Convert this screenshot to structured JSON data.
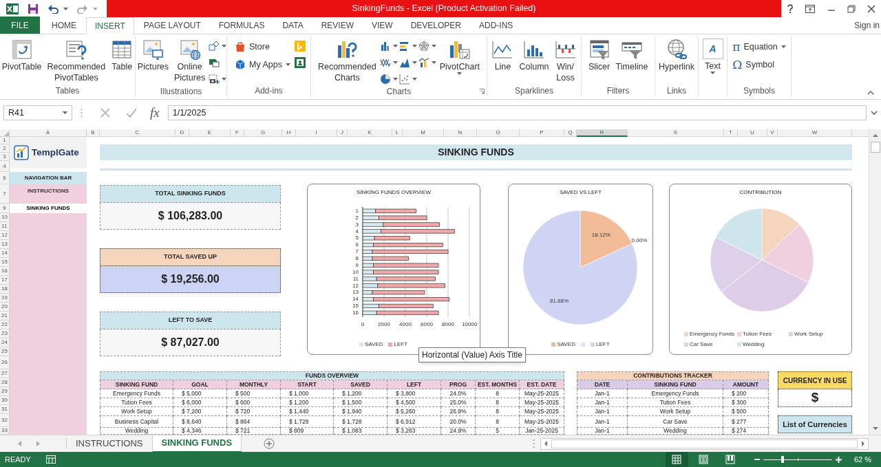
{
  "window": {
    "title": "SinkingFunds -  Excel (Product Activation Failed)"
  },
  "ribbon_tabs": [
    {
      "label": "FILE",
      "kind": "file",
      "selected": false
    },
    {
      "label": "HOME",
      "kind": "tab",
      "selected": false
    },
    {
      "label": "INSERT",
      "kind": "tab",
      "selected": true
    },
    {
      "label": "PAGE LAYOUT",
      "kind": "tab",
      "selected": false
    },
    {
      "label": "FORMULAS",
      "kind": "tab",
      "selected": false
    },
    {
      "label": "DATA",
      "kind": "tab",
      "selected": false
    },
    {
      "label": "REVIEW",
      "kind": "tab",
      "selected": false
    },
    {
      "label": "VIEW",
      "kind": "tab",
      "selected": false
    },
    {
      "label": "DEVELOPER",
      "kind": "tab",
      "selected": false
    },
    {
      "label": "ADD-INS",
      "kind": "tab",
      "selected": false
    }
  ],
  "sign_in": "Sign in",
  "ribbon_groups": [
    {
      "label": "Tables",
      "items": [
        {
          "kind": "large",
          "label": "PivotTable"
        },
        {
          "kind": "large",
          "label": "Recommended\nPivotTables"
        },
        {
          "kind": "large",
          "label": "Table"
        }
      ]
    },
    {
      "label": "Illustrations",
      "items": [
        {
          "kind": "large",
          "label": "Pictures"
        },
        {
          "kind": "large",
          "label": "Online\nPictures"
        },
        {
          "kind": "stack",
          "icons": [
            {
              "dropdown": true
            },
            {
              "dropdown": false
            },
            {
              "dropdown": true
            }
          ]
        }
      ]
    },
    {
      "label": "Add-ins",
      "items": [
        {
          "kind": "rows",
          "entries": [
            {
              "label": "Store",
              "dropdown": false
            },
            {
              "label": "My Apps",
              "dropdown": true
            }
          ]
        },
        {
          "kind": "stack",
          "icons": [
            {
              "dropdown": false
            },
            {
              "dropdown": false
            }
          ]
        }
      ]
    },
    {
      "label": "Charts",
      "launcher": true,
      "items": [
        {
          "kind": "large",
          "label": "Recommended\nCharts"
        },
        {
          "kind": "stack",
          "icons": [
            {
              "dropdown": true
            },
            {
              "dropdown": true
            },
            {
              "dropdown": true
            }
          ]
        },
        {
          "kind": "stack",
          "icons": [
            {
              "dropdown": true
            },
            {
              "dropdown": true
            },
            {
              "dropdown": true
            }
          ]
        },
        {
          "kind": "stack",
          "icons": [
            {
              "dropdown": true
            },
            {
              "dropdown": true
            }
          ]
        },
        {
          "kind": "large",
          "label": "PivotChart",
          "dropdown": true
        }
      ]
    },
    {
      "label": "Sparklines",
      "items": [
        {
          "kind": "large",
          "label": "Line"
        },
        {
          "kind": "large",
          "label": "Column"
        },
        {
          "kind": "large",
          "label": "Win/\nLoss"
        }
      ]
    },
    {
      "label": "Filters",
      "items": [
        {
          "kind": "large",
          "label": "Slicer"
        },
        {
          "kind": "large",
          "label": "Timeline"
        }
      ]
    },
    {
      "label": "Links",
      "items": [
        {
          "kind": "large",
          "label": "Hyperlink"
        }
      ]
    },
    {
      "items": [
        {
          "kind": "textbox",
          "glyph": "A",
          "label": "Text",
          "dropdown": true
        }
      ]
    },
    {
      "label": "Symbols",
      "items": [
        {
          "kind": "rows",
          "entries": [
            {
              "glyph": "π",
              "label": "Equation",
              "dropdown": true
            },
            {
              "glyph": "Ω",
              "label": "Symbol",
              "dropdown": false
            }
          ]
        }
      ]
    }
  ],
  "formula_bar": {
    "name_box": "R41",
    "function_button": "fx",
    "value": "1/1/2025"
  },
  "columns": [
    {
      "label": "A",
      "selected": false
    },
    {
      "label": "B",
      "selected": false
    },
    {
      "label": "C",
      "selected": false
    },
    {
      "label": "D",
      "selected": false
    },
    {
      "label": "E",
      "selected": false
    },
    {
      "label": "F",
      "selected": false
    },
    {
      "label": "G",
      "selected": false
    },
    {
      "label": "H",
      "selected": false
    },
    {
      "label": "I",
      "selected": false
    },
    {
      "label": "J",
      "selected": false
    },
    {
      "label": "K",
      "selected": false
    },
    {
      "label": "L",
      "selected": false
    },
    {
      "label": "M",
      "selected": false
    },
    {
      "label": "N",
      "selected": false
    },
    {
      "label": "O",
      "selected": false
    },
    {
      "label": "P",
      "selected": false
    },
    {
      "label": "Q",
      "selected": false
    },
    {
      "label": "R",
      "selected": true
    },
    {
      "label": "S",
      "selected": false
    },
    {
      "label": "T",
      "selected": false
    },
    {
      "label": "U",
      "selected": false
    },
    {
      "label": "V",
      "selected": false
    },
    {
      "label": "W",
      "selected": false
    }
  ],
  "row_headers": [
    "1",
    "2",
    "3",
    "4",
    "6",
    "7",
    "9",
    "10",
    "11",
    "12",
    "13",
    "14",
    "15",
    "16",
    "17",
    "18",
    "19",
    "20",
    "21",
    "22",
    "23",
    "24",
    "25",
    "26",
    "27",
    "28",
    "29",
    "30",
    "31",
    "32",
    "33"
  ],
  "logo": {
    "text": "TemplGate"
  },
  "navigation": {
    "title": "NAVIGATION BAR",
    "items": [
      {
        "label": "INSTRUCTIONS",
        "selected": false
      },
      {
        "label": "SINKING FUNDS",
        "selected": true
      }
    ]
  },
  "sheet_title": "SINKING FUNDS",
  "summary_cards": [
    {
      "label": "TOTAL SINKING FUNDS",
      "value": "$ 106,283.00"
    },
    {
      "label": "TOTAL SAVED UP",
      "value": "$ 19,256.00"
    },
    {
      "label": "LEFT TO SAVE",
      "value": "$ 87,027.00"
    }
  ],
  "charts": [
    {
      "chart_data": {
        "type": "bar",
        "orientation": "horizontal",
        "stacked": true,
        "grid": true,
        "legend": "bottom",
        "title": "SINKING FUNDS OVERVIEW",
        "categories": [
          "1",
          "2",
          "3",
          "4",
          "5",
          "6",
          "7",
          "8",
          "9",
          "10",
          "11",
          "12",
          "13",
          "14",
          "15",
          "16"
        ],
        "series": [
          {
            "name": "SAVED",
            "color": "#d5eaf0",
            "values": [
              1200,
              1500,
              1900,
              1700,
              1100,
              1000,
              900,
              900,
              1000,
              1000,
              1300,
              1400,
              900,
              1000,
              1500,
              1300
            ]
          },
          {
            "name": "LEFT",
            "color": "#f0a8a8",
            "values": [
              3800,
              4500,
              5300,
              6900,
              3300,
              6500,
              7100,
              3400,
              6100,
              6100,
              5500,
              6300,
              4900,
              7100,
              5100,
              5800
            ]
          }
        ],
        "xlim": [
          0,
          10000
        ],
        "xticks": [
          0,
          2000,
          4000,
          6000,
          8000,
          10000
        ]
      }
    },
    {
      "chart_data": {
        "type": "pie",
        "legend": "bottom",
        "title": "SAVED VS LEFT",
        "categories": [
          "SAVED",
          null,
          "LEFT"
        ],
        "values": [
          18.12,
          0,
          81.88
        ],
        "value_labels": [
          "18.12%",
          "0.00%",
          "81.88%"
        ]
      }
    },
    {
      "chart_data": {
        "type": "pie",
        "legend": "bottom",
        "title": "CONTRIBUTION",
        "categories": [
          "Emergency Funds",
          "Tution Fees",
          "Work Setup",
          "Car Save",
          "Wedding"
        ],
        "values": [
          12.9,
          19.3,
          32.2,
          17.9,
          17.7
        ]
      }
    }
  ],
  "tooltip": "Horizontal (Value) Axis Title",
  "funds_overview": {
    "title": "FUNDS OVERVIEW",
    "columns": [
      "SINKING FUND",
      "GOAL",
      "MONTHLY",
      "START",
      "SAVED",
      "LEFT",
      "PROG",
      "EST. MONTHS",
      "EST. DATE"
    ],
    "rows": [
      [
        "Emergency Funds",
        "$ 5,000",
        "$ 500",
        "$ 1,000",
        "$ 1,200",
        "$ 3,800",
        "24.0%",
        "8",
        "May-25-2025"
      ],
      [
        "Tution Fees",
        "$ 6,000",
        "$ 600",
        "$ 1,200",
        "$ 1,500",
        "$ 4,500",
        "25.0%",
        "8",
        "May-25-2025"
      ],
      [
        "Work Setup",
        "$ 7,200",
        "$ 720",
        "$ 1,440",
        "$ 1,940",
        "$ 5,260",
        "26.9%",
        "8",
        "May-25-2025"
      ],
      [
        "Business Capital",
        "$ 8,640",
        "$ 864",
        "$ 1,728",
        "$ 1,728",
        "$ 6,912",
        "20.0%",
        "8",
        "May-25-2025"
      ],
      [
        "Wedding",
        "$ 4,346",
        "$ 721",
        "$ 809",
        "$ 1,083",
        "$ 3,263",
        "24.9%",
        "5",
        "Jan-25-2025"
      ]
    ]
  },
  "contributions_tracker": {
    "title": "CONTRIBUTIONS TRACKER",
    "columns": [
      "DATE",
      "SINKING FUND",
      "AMOUNT"
    ],
    "rows": [
      [
        "Jan-1",
        "Emergency Funds",
        "$ 200"
      ],
      [
        "Jan-1",
        "Tution Fees",
        "$ 300"
      ],
      [
        "Jan-1",
        "Work Setup",
        "$ 500"
      ],
      [
        "Jan-1",
        "Car Save",
        "$ 277"
      ],
      [
        "Jan-1",
        "Wedding",
        "$ 274"
      ]
    ]
  },
  "currency": {
    "label": "CURRENCY IN USE",
    "value": "$"
  },
  "currency_list": {
    "label": "List of Currencies"
  },
  "sheet_tabs": [
    {
      "label": "INSTRUCTIONS",
      "selected": false
    },
    {
      "label": "SINKING FUNDS",
      "selected": true
    }
  ],
  "status_bar": {
    "mode": "READY",
    "views": [
      {
        "kind": "normal",
        "selected": true
      },
      {
        "kind": "page_layout",
        "selected": false
      },
      {
        "kind": "page_break",
        "selected": false
      }
    ],
    "zoom": {
      "level": 0.28,
      "reading": "62 %"
    }
  }
}
